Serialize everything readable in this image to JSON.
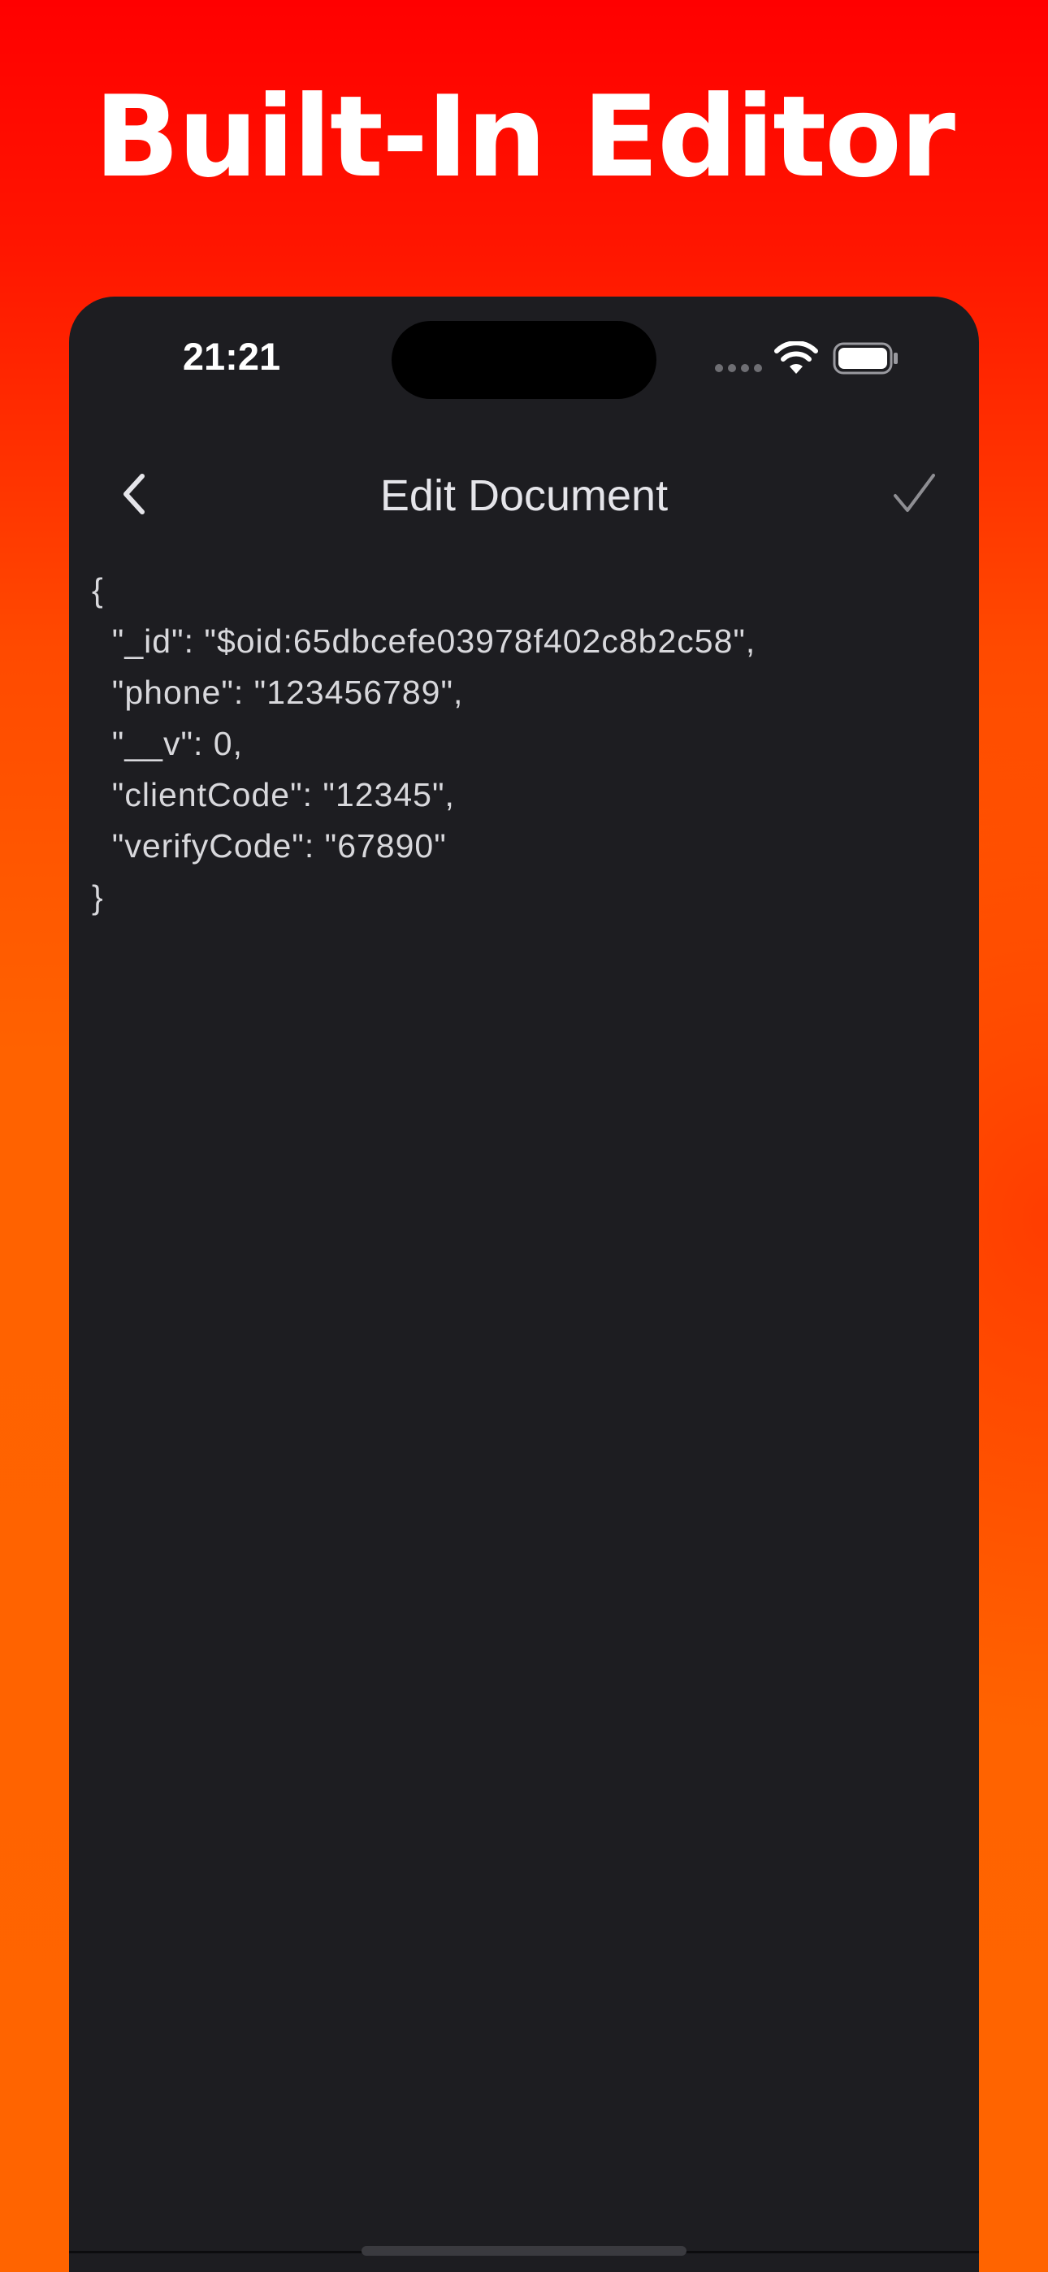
{
  "banner": {
    "headline": "Built-In Editor"
  },
  "status_bar": {
    "time": "21:21",
    "signal_icon": "cellular-signal-icon",
    "wifi_icon": "wifi-icon",
    "battery_icon": "battery-full-icon"
  },
  "nav": {
    "back_icon": "chevron-left-icon",
    "title": "Edit Document",
    "done_icon": "checkmark-icon"
  },
  "editor": {
    "content": "{\n  \"_id\": \"$oid:65dbcefe03978f402c8b2c58\",\n  \"phone\": \"123456789\",\n  \"__v\": 0,\n  \"clientCode\": \"12345\",\n  \"verifyCode\": \"67890\"\n}"
  },
  "colors": {
    "background_top": "#ff0000",
    "background_bottom": "#ff6400",
    "device_background": "#1d1d21",
    "text_primary": "#e5e5ea",
    "icon_gray": "#8e8e93"
  }
}
